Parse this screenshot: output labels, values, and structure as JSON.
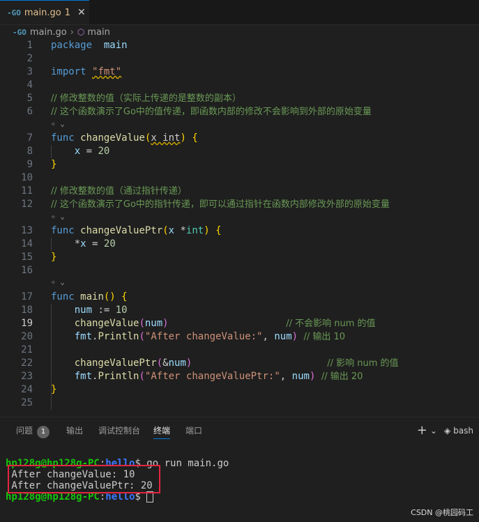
{
  "tab": {
    "icon": "go-file-icon",
    "filename": "main.go",
    "problems": "1",
    "close": "✕"
  },
  "breadcrumb": {
    "file": "main.go",
    "symbol": "main"
  },
  "code_lines": [
    {
      "n": "1",
      "tokens": [
        [
          "kw",
          "package"
        ],
        [
          "",
          "  "
        ],
        [
          "var",
          "main"
        ]
      ]
    },
    {
      "n": "2",
      "tokens": []
    },
    {
      "n": "3",
      "tokens": [
        [
          "kw",
          "import"
        ],
        [
          "",
          " "
        ],
        [
          "squig-str",
          "\"fmt\""
        ]
      ]
    },
    {
      "n": "4",
      "tokens": []
    },
    {
      "n": "5",
      "tokens": [
        [
          "cmt",
          "// 修改整数的值（实际上传递的是整数的副本）"
        ]
      ]
    },
    {
      "n": "6",
      "tokens": [
        [
          "cmt",
          "// 这个函数演示了Go中的值传递，即函数内部的修改不会影响到外部的原始变量"
        ]
      ]
    },
    {
      "n": "7",
      "tokens": [
        [
          "kw",
          "func"
        ],
        [
          "",
          " "
        ],
        [
          "fn",
          "changeValue"
        ],
        [
          "br1",
          "("
        ],
        [
          "squig",
          "x int"
        ],
        [
          "br1",
          ")"
        ],
        [
          "",
          " "
        ],
        [
          "br1",
          "{"
        ]
      ]
    },
    {
      "n": "8",
      "tokens": [
        [
          "",
          "    "
        ],
        [
          "var",
          "x"
        ],
        [
          "",
          " = "
        ],
        [
          "num",
          "20"
        ]
      ]
    },
    {
      "n": "9",
      "tokens": [
        [
          "br1",
          "}"
        ]
      ]
    },
    {
      "n": "10",
      "tokens": []
    },
    {
      "n": "11",
      "tokens": [
        [
          "cmt",
          "// 修改整数的值（通过指针传递）"
        ]
      ]
    },
    {
      "n": "12",
      "tokens": [
        [
          "cmt",
          "// 这个函数演示了Go中的指针传递，即可以通过指针在函数内部修改外部的原始变量"
        ]
      ]
    },
    {
      "n": "13",
      "tokens": [
        [
          "kw",
          "func"
        ],
        [
          "",
          " "
        ],
        [
          "fn",
          "changeValuePtr"
        ],
        [
          "br1",
          "("
        ],
        [
          "var",
          "x"
        ],
        [
          "",
          " *"
        ],
        [
          "typ",
          "int"
        ],
        [
          "br1",
          ")"
        ],
        [
          "",
          " "
        ],
        [
          "br1",
          "{"
        ]
      ]
    },
    {
      "n": "14",
      "tokens": [
        [
          "",
          "    *"
        ],
        [
          "var",
          "x"
        ],
        [
          "",
          " = "
        ],
        [
          "num",
          "20"
        ]
      ]
    },
    {
      "n": "15",
      "tokens": [
        [
          "br1",
          "}"
        ]
      ]
    },
    {
      "n": "16",
      "tokens": []
    },
    {
      "n": "17",
      "tokens": [
        [
          "kw",
          "func"
        ],
        [
          "",
          " "
        ],
        [
          "fn",
          "main"
        ],
        [
          "br1",
          "()"
        ],
        [
          "",
          " "
        ],
        [
          "br1",
          "{"
        ]
      ]
    },
    {
      "n": "18",
      "tokens": [
        [
          "",
          "    "
        ],
        [
          "var",
          "num"
        ],
        [
          "",
          " := "
        ],
        [
          "num",
          "10"
        ]
      ]
    },
    {
      "n": "19",
      "tokens": [
        [
          "",
          "    "
        ],
        [
          "fn",
          "changeValue"
        ],
        [
          "br2",
          "("
        ],
        [
          "var",
          "num"
        ],
        [
          "br2",
          ")"
        ],
        [
          "",
          "                    "
        ],
        [
          "cmt",
          "// 不会影响 num 的值"
        ]
      ]
    },
    {
      "n": "20",
      "tokens": [
        [
          "",
          "    "
        ],
        [
          "var",
          "fmt"
        ],
        [
          "",
          "."
        ],
        [
          "fn",
          "Println"
        ],
        [
          "br2",
          "("
        ],
        [
          "str",
          "\"After changeValue:\""
        ],
        [
          "",
          ", "
        ],
        [
          "var",
          "num"
        ],
        [
          "br2",
          ")"
        ],
        [
          "",
          " "
        ],
        [
          "cmt",
          "// 输出 10"
        ]
      ]
    },
    {
      "n": "21",
      "tokens": []
    },
    {
      "n": "22",
      "tokens": [
        [
          "",
          "    "
        ],
        [
          "fn",
          "changeValuePtr"
        ],
        [
          "br2",
          "("
        ],
        [
          "",
          "&"
        ],
        [
          "var",
          "num"
        ],
        [
          "br2",
          ")"
        ],
        [
          "",
          "                       "
        ],
        [
          "cmt",
          "// 影响 num 的值"
        ]
      ]
    },
    {
      "n": "23",
      "tokens": [
        [
          "",
          "    "
        ],
        [
          "var",
          "fmt"
        ],
        [
          "",
          "."
        ],
        [
          "fn",
          "Println"
        ],
        [
          "br2",
          "("
        ],
        [
          "str",
          "\"After changeValuePtr:\""
        ],
        [
          "",
          ", "
        ],
        [
          "var",
          "num"
        ],
        [
          "br2",
          ")"
        ],
        [
          "",
          " "
        ],
        [
          "cmt",
          "// 输出 20"
        ]
      ]
    },
    {
      "n": "24",
      "tokens": [
        [
          "br1",
          "}"
        ]
      ]
    },
    {
      "n": "25",
      "tokens": []
    }
  ],
  "panel": {
    "tabs": [
      "问题",
      "输出",
      "调试控制台",
      "终端",
      "端口"
    ],
    "problems_count": "1",
    "active_tab": "终端",
    "add": "+",
    "dropdown": "⌄",
    "shell": "bash"
  },
  "terminal": {
    "lines": [
      {
        "user": "hp128g@hp128g-PC",
        "path": "hello",
        "cmd": "$ go run main.go"
      },
      {
        "out": "After changeValue: 10"
      },
      {
        "out": "After changeValuePtr: 20"
      },
      {
        "user": "hp128g@hp128g-PC",
        "path": "hello",
        "cmd": "$ ",
        "cursor": true
      }
    ]
  },
  "watermark": "CSDN @桃园码工",
  "colors": {
    "accent": "#0078d4",
    "highlight_box": "#e3263f",
    "prompt_user": "#16c60c",
    "prompt_path": "#3b78ff"
  }
}
